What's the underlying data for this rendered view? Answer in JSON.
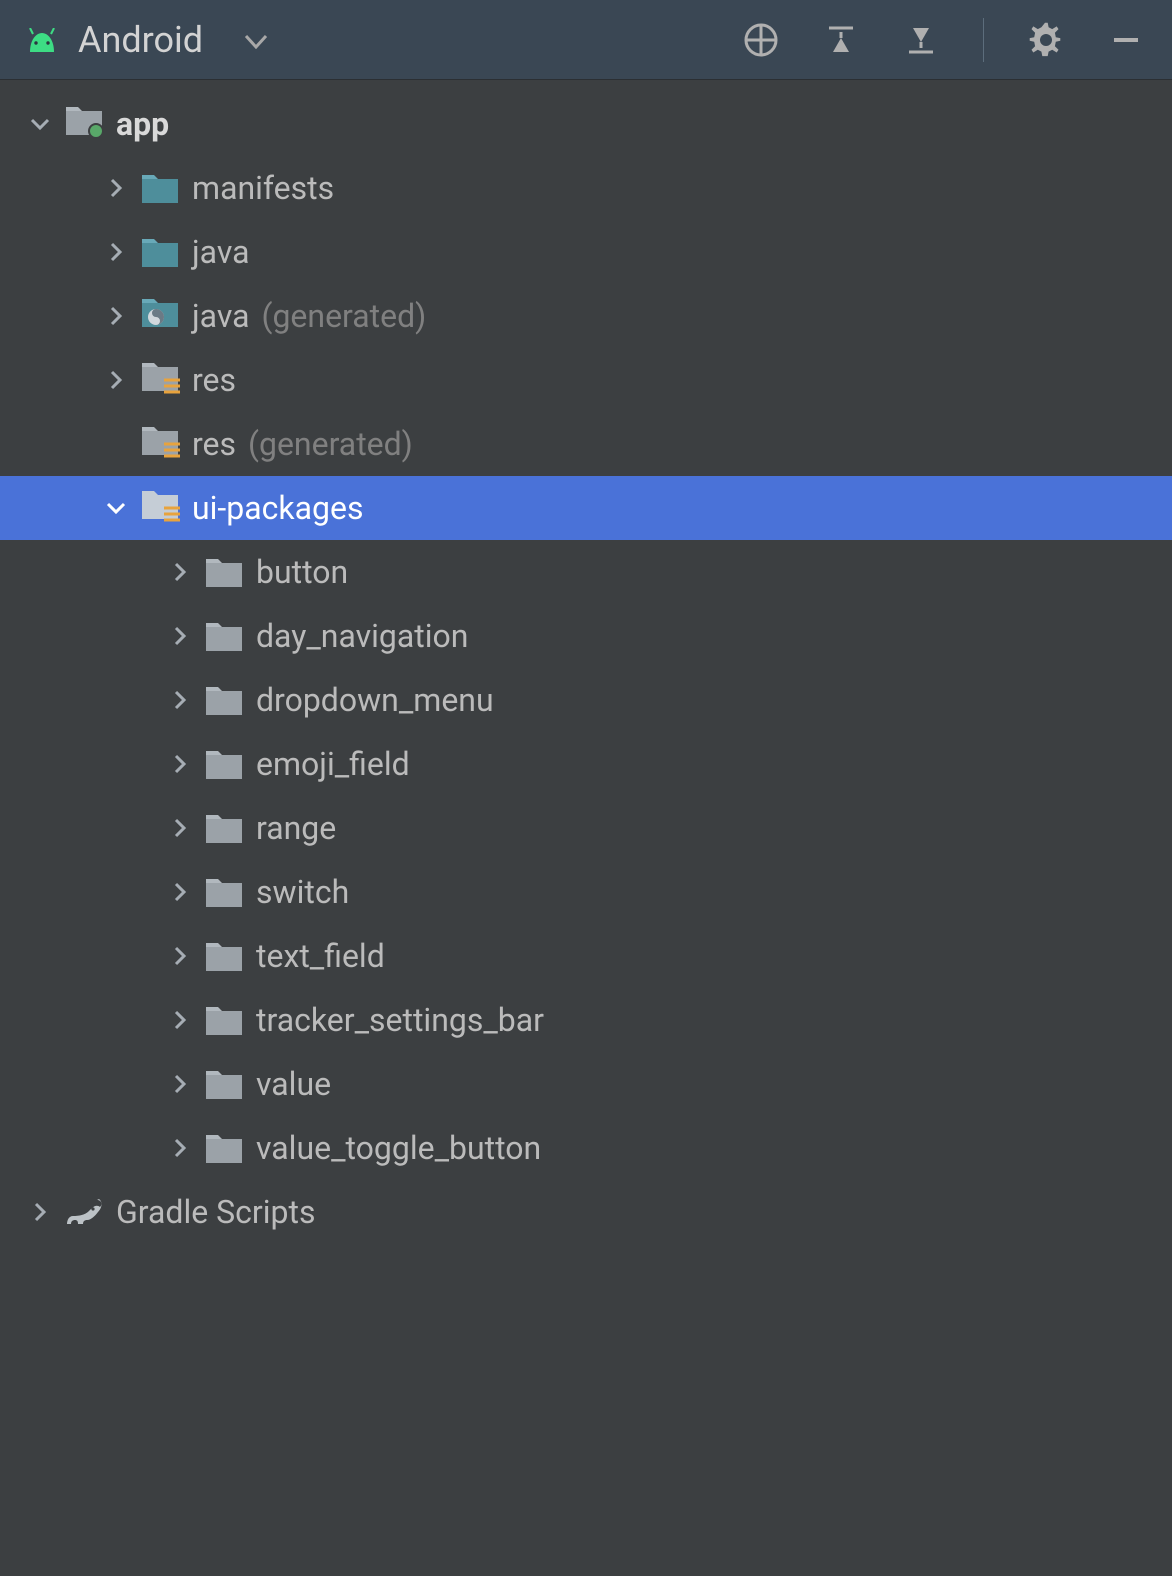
{
  "header": {
    "view_label": "Android"
  },
  "tree": {
    "root": {
      "label": "app",
      "children": [
        {
          "label": "manifests"
        },
        {
          "label": "java"
        },
        {
          "label": "java",
          "secondary": "(generated)"
        },
        {
          "label": "res"
        },
        {
          "label": "res",
          "secondary": "(generated)"
        },
        {
          "label": "ui-packages",
          "children": [
            {
              "label": "button"
            },
            {
              "label": "day_navigation"
            },
            {
              "label": "dropdown_menu"
            },
            {
              "label": "emoji_field"
            },
            {
              "label": "range"
            },
            {
              "label": "switch"
            },
            {
              "label": "text_field"
            },
            {
              "label": "tracker_settings_bar"
            },
            {
              "label": "value"
            },
            {
              "label": "value_toggle_button"
            }
          ]
        }
      ]
    },
    "gradle": {
      "label": "Gradle Scripts"
    }
  }
}
